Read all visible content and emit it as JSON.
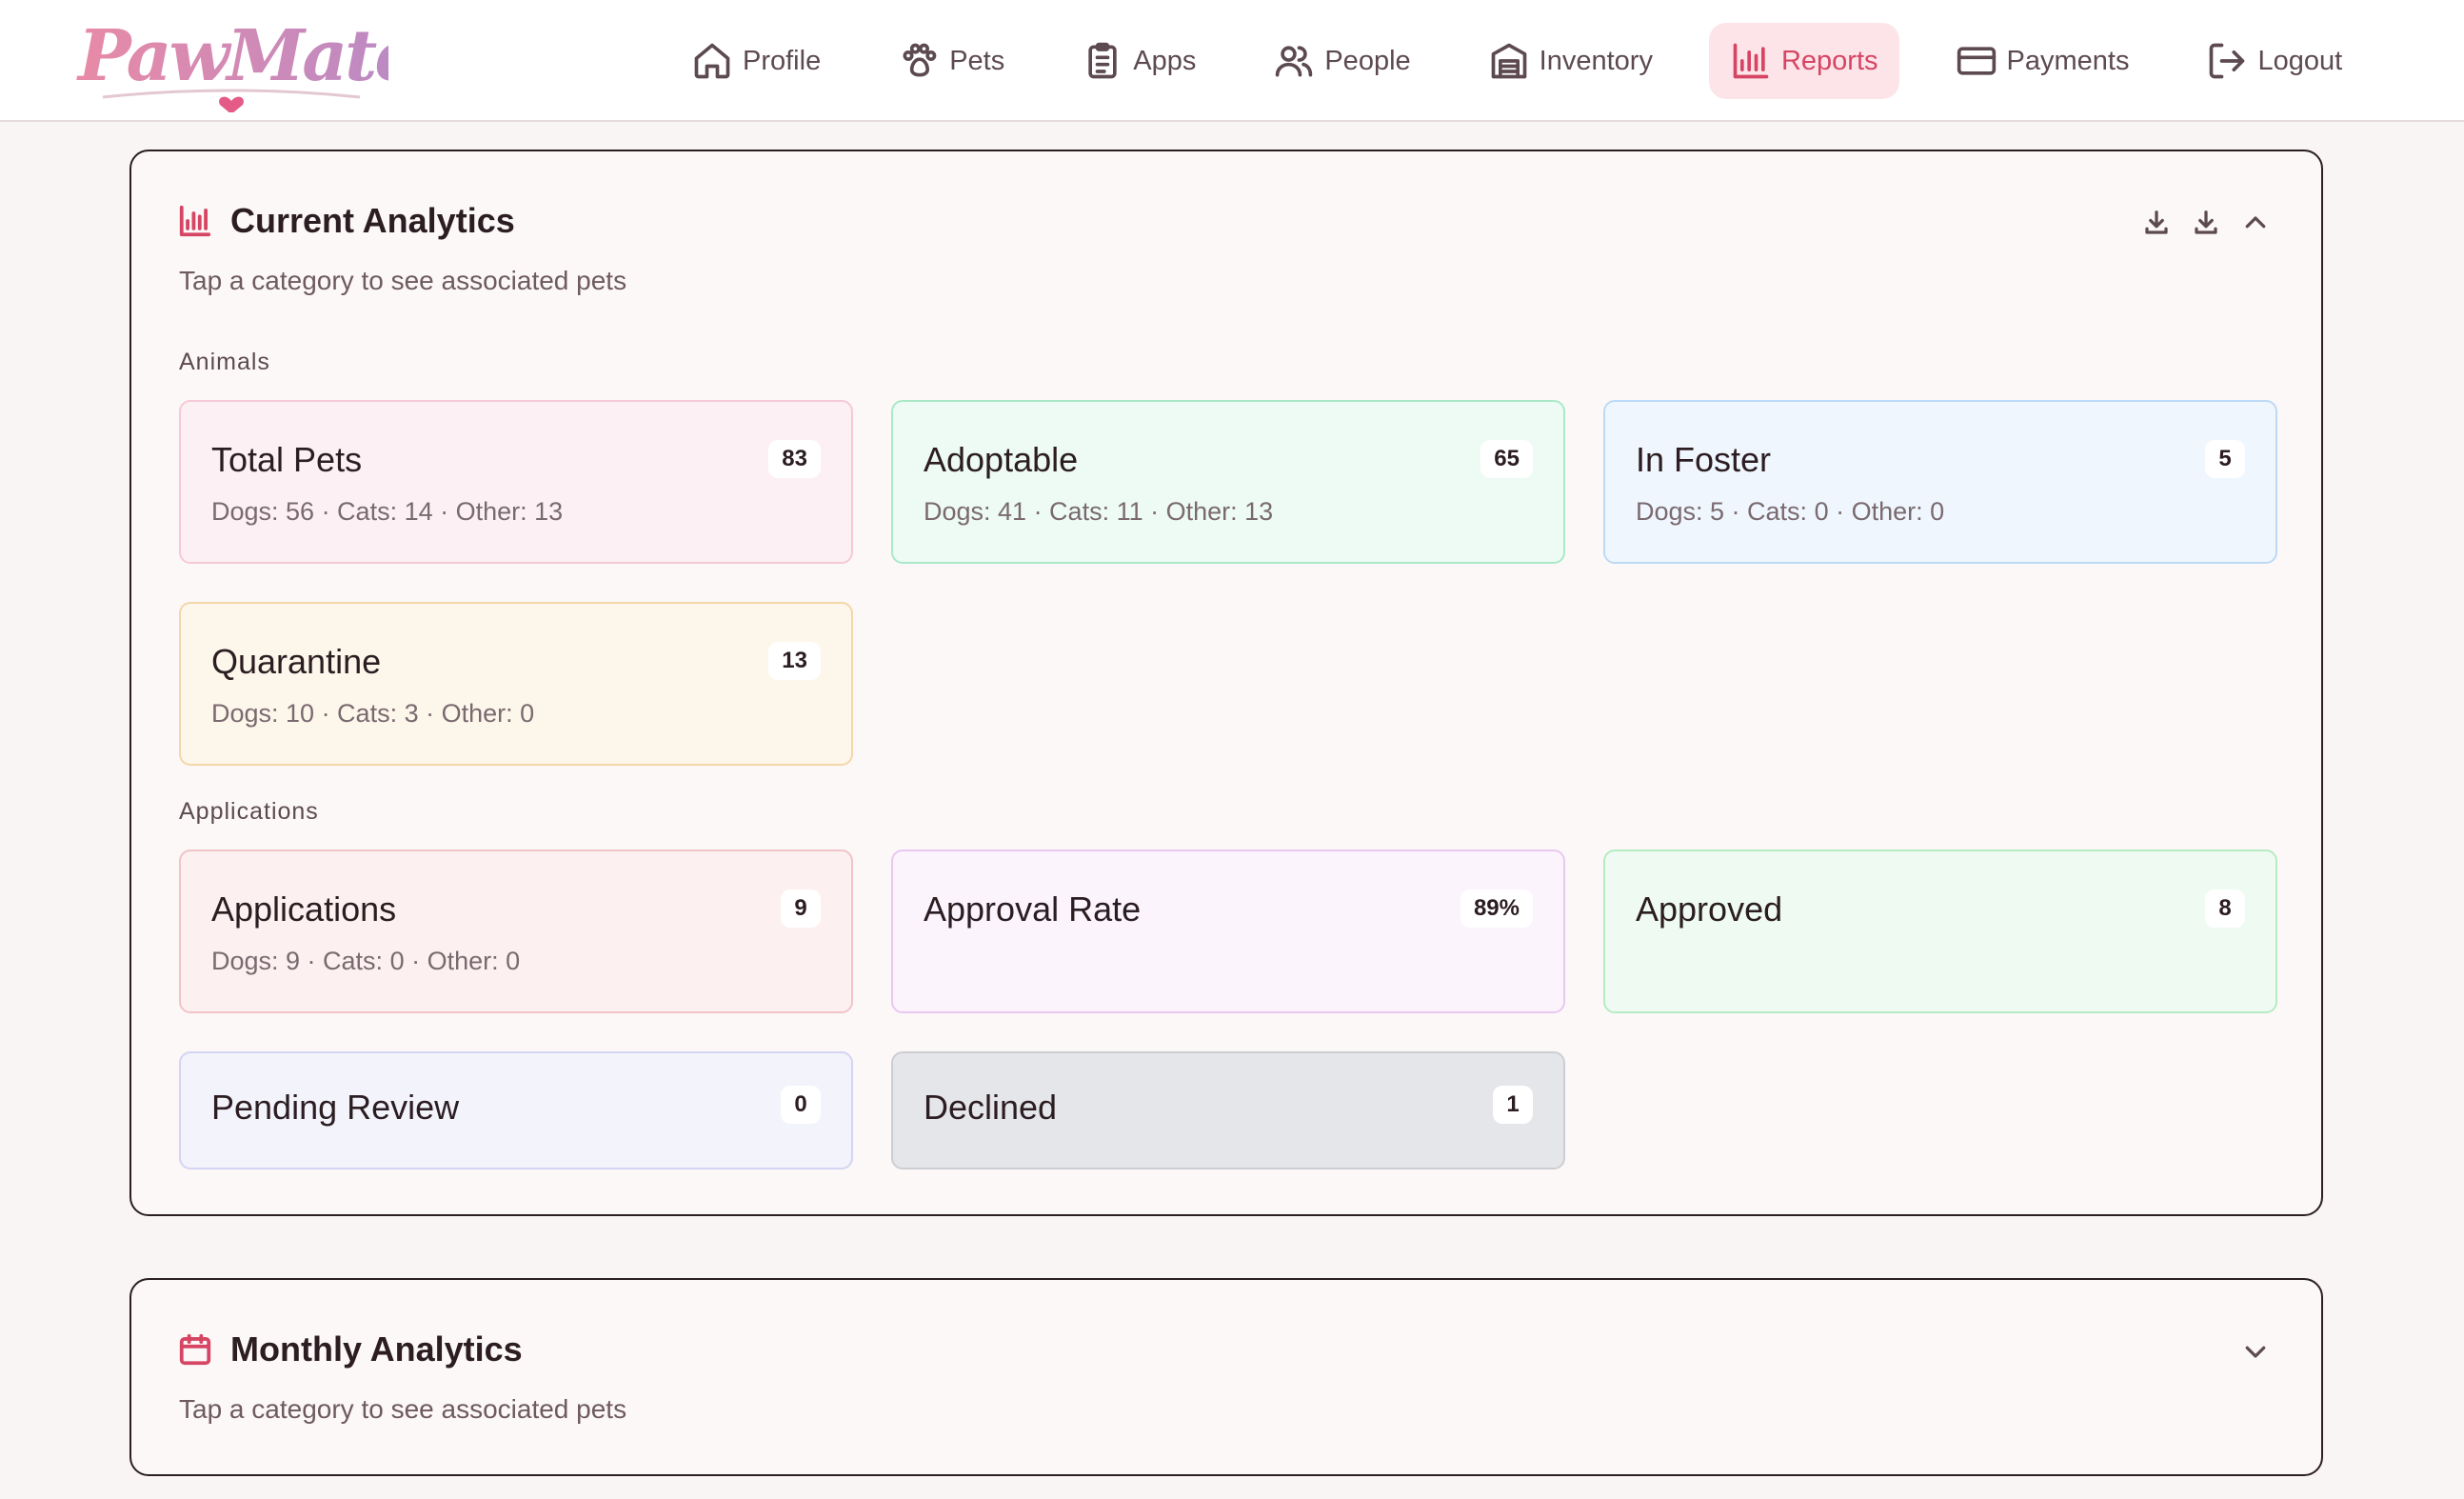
{
  "brand": {
    "name": "PawMates",
    "accent": "#d64563"
  },
  "nav": {
    "items": [
      {
        "label": "Profile",
        "icon": "home-icon"
      },
      {
        "label": "Pets",
        "icon": "paw-icon"
      },
      {
        "label": "Apps",
        "icon": "clipboard-icon"
      },
      {
        "label": "People",
        "icon": "users-icon"
      },
      {
        "label": "Inventory",
        "icon": "warehouse-icon"
      },
      {
        "label": "Reports",
        "icon": "bar-chart-icon",
        "active": true
      },
      {
        "label": "Payments",
        "icon": "credit-card-icon"
      },
      {
        "label": "Logout",
        "icon": "logout-icon"
      }
    ]
  },
  "current": {
    "title": "Current Analytics",
    "subtitle": "Tap a category to see associated pets",
    "sections": {
      "animals": "Animals",
      "applications": "Applications"
    },
    "cards": {
      "total_pets": {
        "title": "Total Pets",
        "count": "83",
        "detail": "Dogs: 56 · Cats: 14 · Other: 13"
      },
      "adoptable": {
        "title": "Adoptable",
        "count": "65",
        "detail": "Dogs: 41 · Cats: 11 · Other: 13"
      },
      "in_foster": {
        "title": "In Foster",
        "count": "5",
        "detail": "Dogs: 5 · Cats: 0 · Other: 0"
      },
      "quarantine": {
        "title": "Quarantine",
        "count": "13",
        "detail": "Dogs: 10 · Cats: 3 · Other: 0"
      },
      "applications": {
        "title": "Applications",
        "count": "9",
        "detail": "Dogs: 9 · Cats: 0 · Other: 0"
      },
      "approval_rate": {
        "title": "Approval Rate",
        "count": "89%"
      },
      "approved": {
        "title": "Approved",
        "count": "8"
      },
      "pending_review": {
        "title": "Pending Review",
        "count": "0"
      },
      "declined": {
        "title": "Declined",
        "count": "1"
      }
    }
  },
  "monthly": {
    "title": "Monthly Analytics",
    "subtitle": "Tap a category to see associated pets"
  }
}
